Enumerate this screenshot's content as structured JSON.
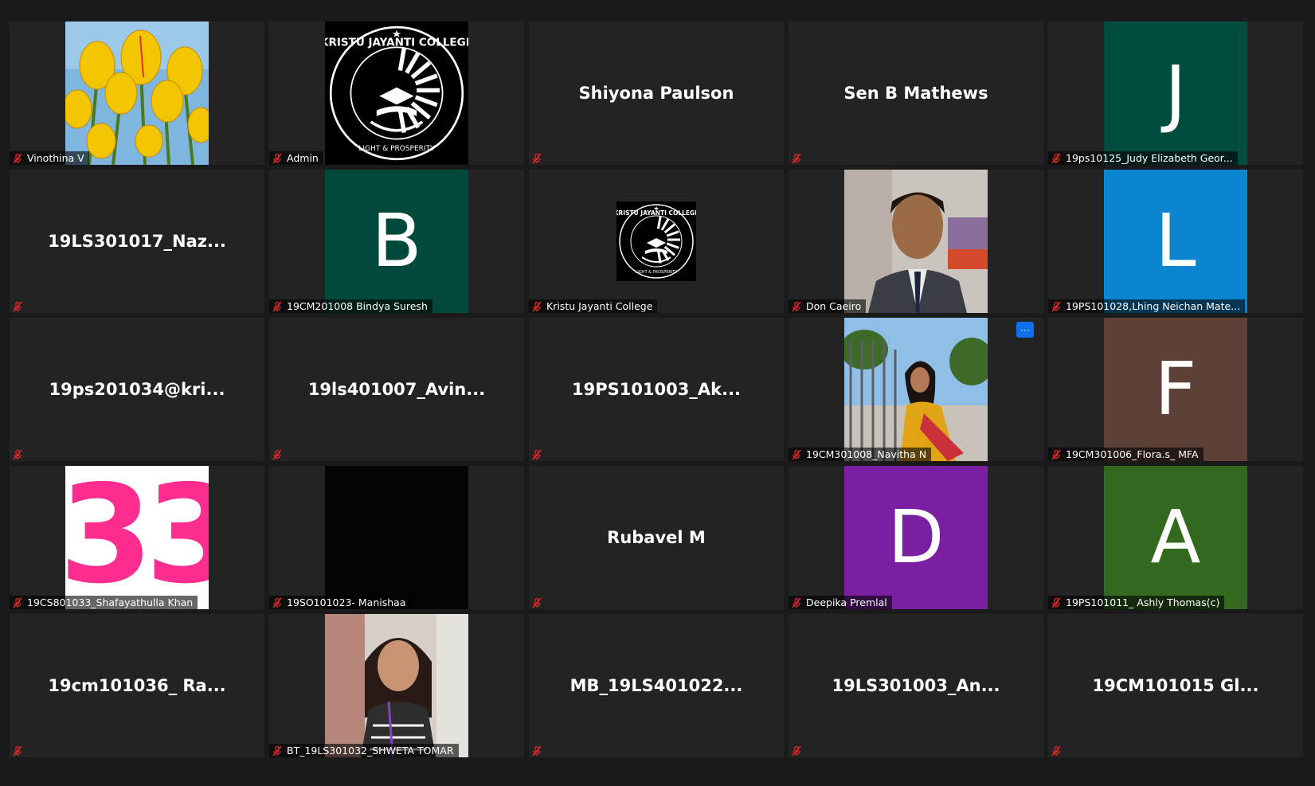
{
  "meeting": {
    "participants": [
      {
        "name": "Vinothina V",
        "display": "photo",
        "photo": "tulips"
      },
      {
        "name": "Admin",
        "display": "photo",
        "photo": "college-logo"
      },
      {
        "name": "",
        "display": "name",
        "big_name": "Shiyona Paulson"
      },
      {
        "name": "",
        "display": "name",
        "big_name": "Sen B Mathews"
      },
      {
        "name": "19ps10125_Judy Elizabeth Geor...",
        "display": "initial",
        "initial": "J",
        "color": "#004c3f"
      },
      {
        "name": "",
        "display": "name",
        "big_name": "19LS301017_Naz..."
      },
      {
        "name": "19CM201008 Bindya Suresh",
        "display": "initial",
        "initial": "B",
        "color": "#00493b"
      },
      {
        "name": "Kristu Jayanti College",
        "display": "photo",
        "photo": "college-logo-small"
      },
      {
        "name": "Don Caeiro",
        "display": "photo",
        "photo": "man-portrait"
      },
      {
        "name": "19PS101028,Lhing Neichan Mate...",
        "display": "initial",
        "initial": "L",
        "color": "#0b85d0"
      },
      {
        "name": "",
        "display": "name",
        "big_name": "19ps201034@kri..."
      },
      {
        "name": "",
        "display": "name",
        "big_name": "19ls401007_Avin..."
      },
      {
        "name": "",
        "display": "name",
        "big_name": "19PS101003_Ak..."
      },
      {
        "name": "19CM301008_Navitha N",
        "display": "photo",
        "photo": "woman-fence",
        "has_menu": true
      },
      {
        "name": "19CM301006_Flora.s_ MFA",
        "display": "initial",
        "initial": "F",
        "color": "#5d4037"
      },
      {
        "name": "19CS801033_Shafayathulla Khan",
        "display": "photo",
        "photo": "number-33",
        "photo_text": "33"
      },
      {
        "name": "19SO101023- Manishaa",
        "display": "photo",
        "photo": "black"
      },
      {
        "name": "",
        "display": "name",
        "big_name": "Rubavel M"
      },
      {
        "name": "Deepika Premlal",
        "display": "initial",
        "initial": "D",
        "color": "#7b1fa2"
      },
      {
        "name": "19PS101011_ Ashly Thomas(c)",
        "display": "initial",
        "initial": "A",
        "color": "#33691e"
      },
      {
        "name": "",
        "display": "name",
        "big_name": "19cm101036_ Ra..."
      },
      {
        "name": "BT_19LS301032_SHWETA TOMAR",
        "display": "photo",
        "photo": "woman-portrait"
      },
      {
        "name": "",
        "display": "name",
        "big_name": "MB_19LS401022..."
      },
      {
        "name": "",
        "display": "name",
        "big_name": "19LS301003_An..."
      },
      {
        "name": "",
        "display": "name",
        "big_name": "19CM101015 Gl..."
      }
    ],
    "icons": {
      "mute": "muted-mic-icon",
      "menu": "more-options-icon"
    },
    "menu_glyph": "···"
  }
}
